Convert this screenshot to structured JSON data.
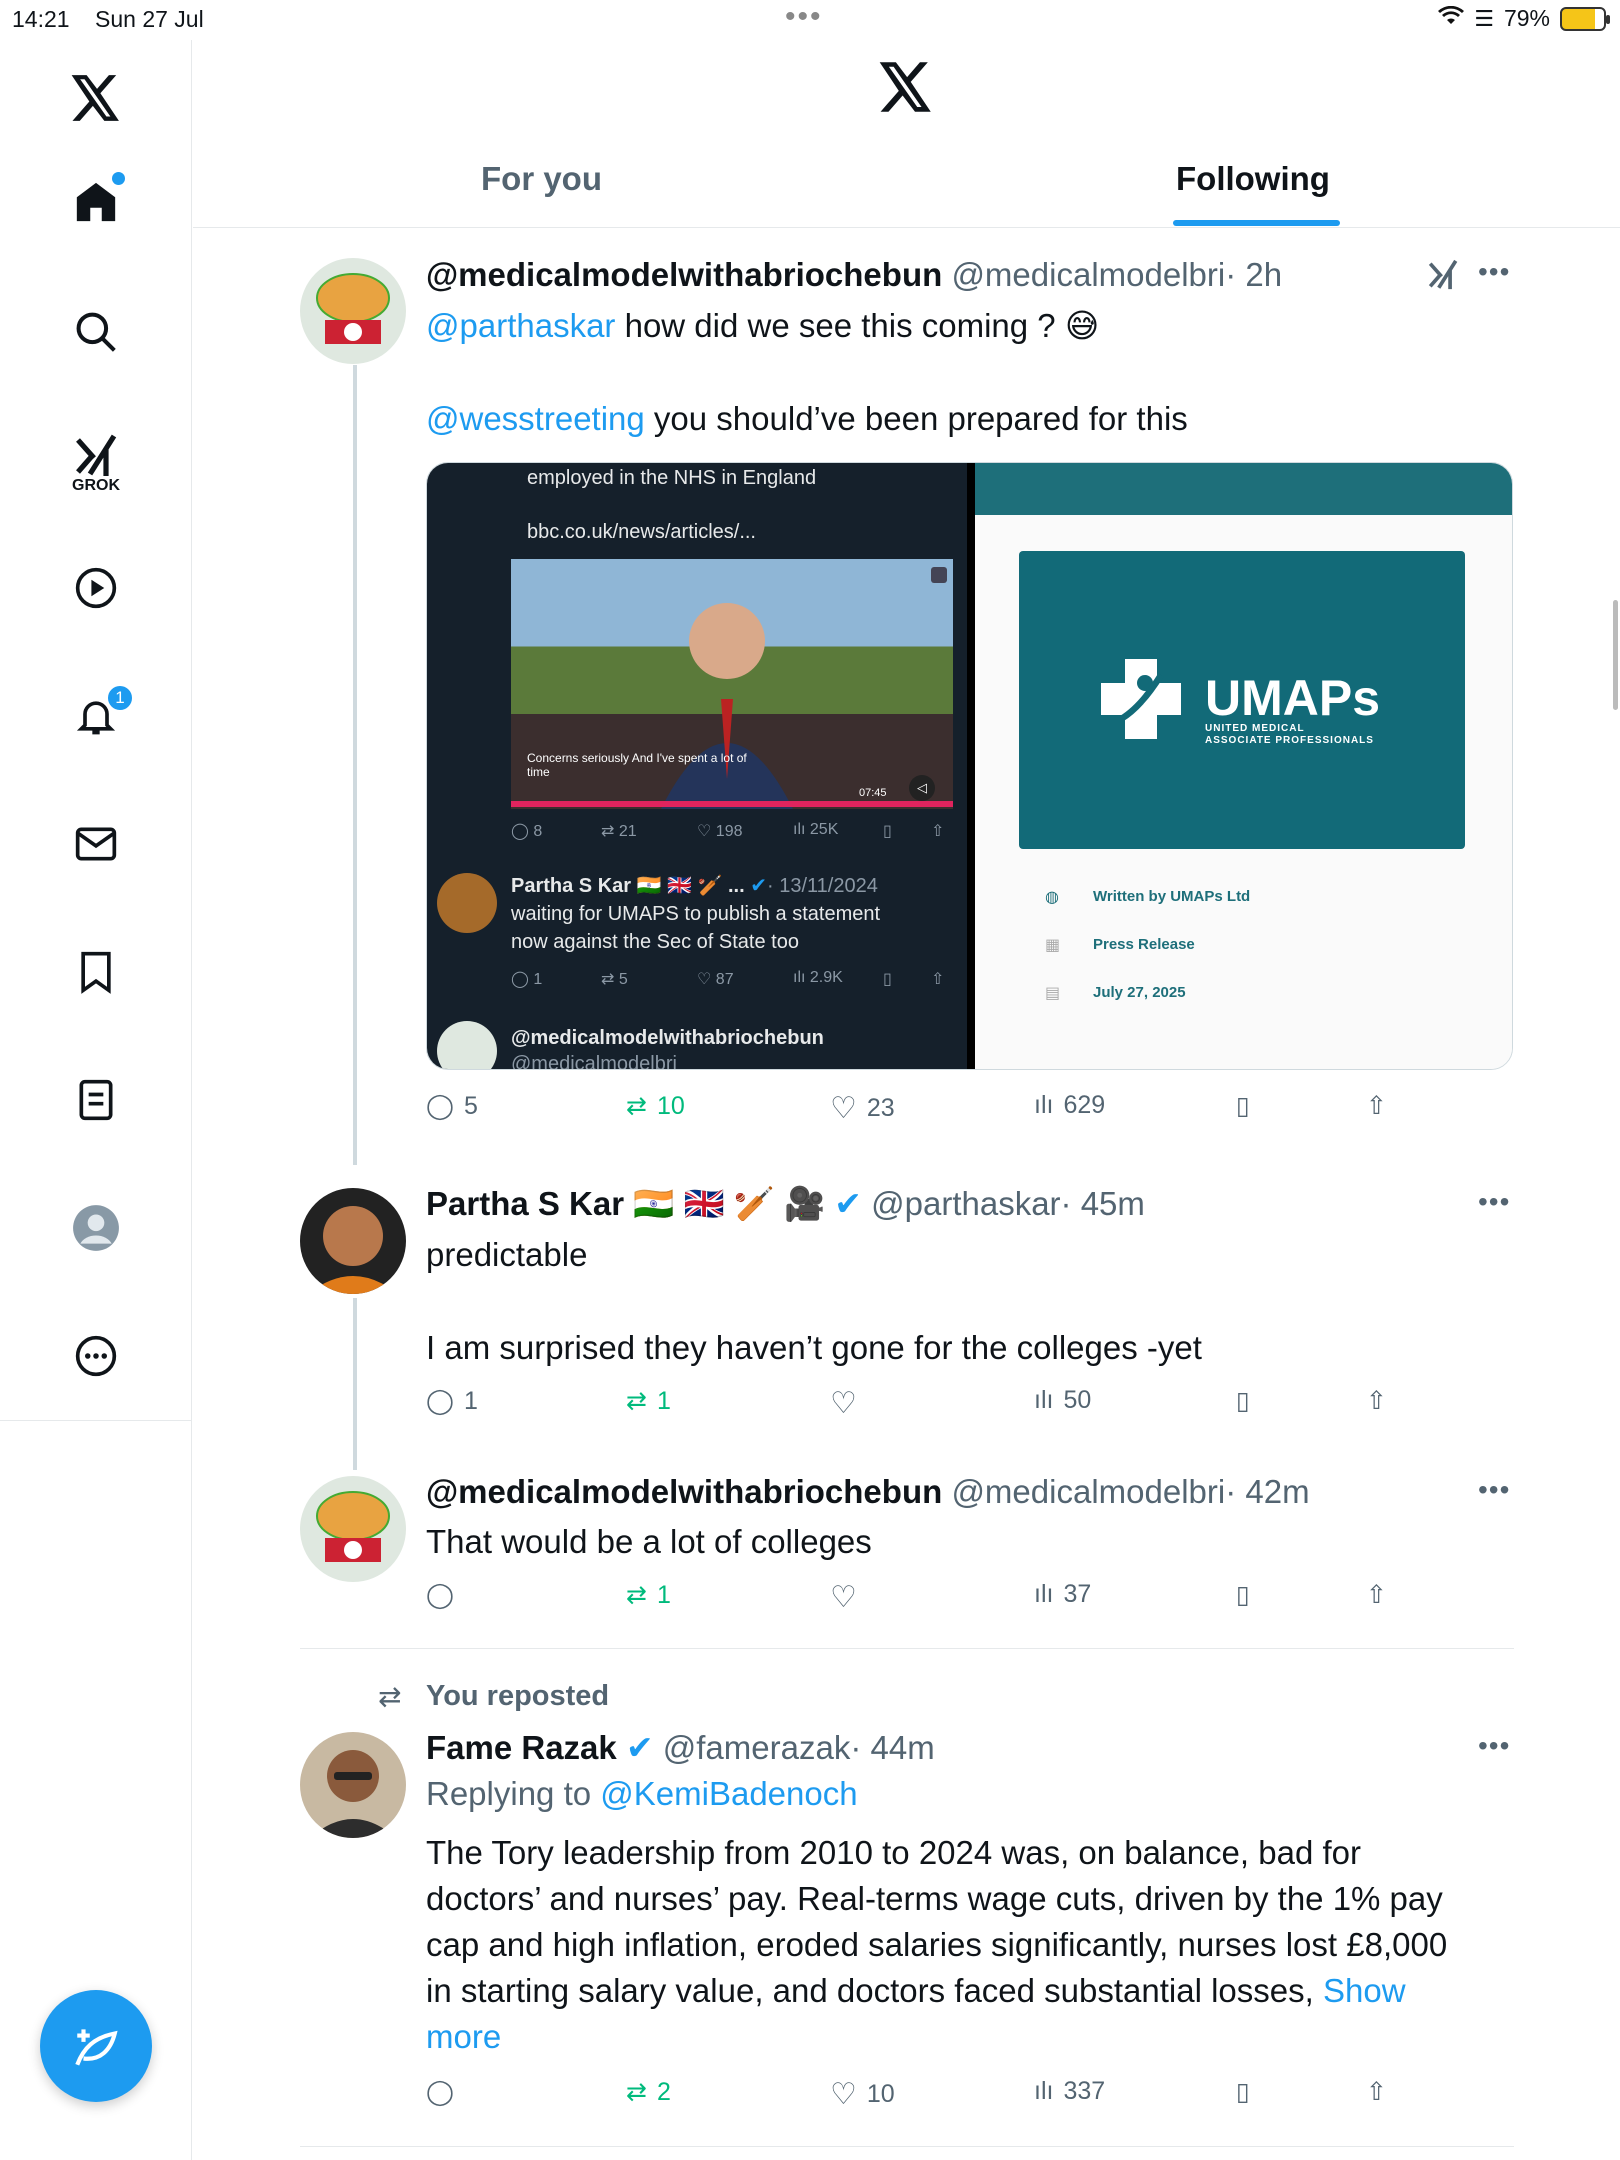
{
  "status_bar": {
    "time": "14:21",
    "date": "Sun 27 Jul",
    "battery": "79%"
  },
  "sidebar": {
    "grok_label": "GROK",
    "notifications_badge": "1",
    "items": [
      "x-logo",
      "home",
      "search",
      "grok",
      "video",
      "notifications",
      "messages",
      "bookmarks",
      "lists",
      "profile",
      "more"
    ]
  },
  "header": {
    "tabs": [
      "For you",
      "Following"
    ],
    "active_tab": "Following"
  },
  "posts": [
    {
      "name": "@medicalmodelwithabriochebun",
      "handle": "@medicalmodelbri",
      "time": "· 2h",
      "line1_mention": "@parthaskar",
      "line1_text": " how did we see this coming ? 😅",
      "line2_mention": "@wesstreeting",
      "line2_text": " you should’ve been prepared for this",
      "media": {
        "left": {
          "top_text": "employed in the NHS in England",
          "link": "bbc.co.uk/news/articles/...",
          "caption": "Concerns seriously And I've spent a lot of time",
          "video_time": "07:45",
          "stats1": [
            "8",
            "21",
            "198",
            "25K"
          ],
          "reply_name": "Partha S Kar 🇮🇳 🇬🇧 🏏 ...",
          "reply_date": "· 13/11/2024",
          "reply_text1": "waiting for UMAPS to publish a statement",
          "reply_text2": "now against the Sec of State too",
          "stats2": [
            "1",
            "5",
            "87",
            "2.9K"
          ],
          "bottom_name": "@medicalmodelwithabriochebun",
          "bottom_handle": "@medicalmodelbri"
        },
        "right": {
          "brand": "UMAPs",
          "brand_sub1": "UNITED MEDICAL",
          "brand_sub2": "ASSOCIATE PROFESSIONALS",
          "written_by": "Written by UMAPs Ltd",
          "category": "Press Release",
          "date": "July 27, 2025"
        }
      },
      "stats": {
        "replies": "5",
        "reposts": "10",
        "likes": "23",
        "views": "629"
      }
    },
    {
      "name": "Partha S Kar 🇮🇳 🇬🇧 🏏 🎥",
      "handle": "@parthaskar",
      "time": "· 45m",
      "line1": "predictable",
      "line2": "I am surprised they haven’t gone for the colleges -yet",
      "stats": {
        "replies": "1",
        "reposts": "1",
        "likes": "",
        "views": "50"
      }
    },
    {
      "name": "@medicalmodelwithabriochebun",
      "handle": "@medicalmodelbri",
      "time": "· 42m",
      "line1": "That would be a lot of colleges",
      "stats": {
        "replies": "",
        "reposts": "1",
        "likes": "",
        "views": "37"
      }
    },
    {
      "repost_label": "You reposted",
      "name": "Fame Razak",
      "handle": "@famerazak",
      "time": "· 44m",
      "replying_prefix": "Replying to ",
      "replying_to": "@KemiBadenoch",
      "lines": [
        "The Tory leadership from 2010 to 2024 was, on balance, bad for",
        "doctors’ and nurses’ pay. Real-terms wage cuts, driven by the 1% pay",
        "cap and high inflation, eroded salaries significantly, nurses lost £8,000",
        "in starting salary value, and doctors faced substantial losses, "
      ],
      "show_more_1": "Show",
      "show_more_2": "more",
      "stats": {
        "replies": "",
        "reposts": "2",
        "likes": "10",
        "views": "337"
      }
    }
  ],
  "colors": {
    "accent": "#1d9bf0",
    "repost": "#00ba7c",
    "muted": "#536471"
  }
}
